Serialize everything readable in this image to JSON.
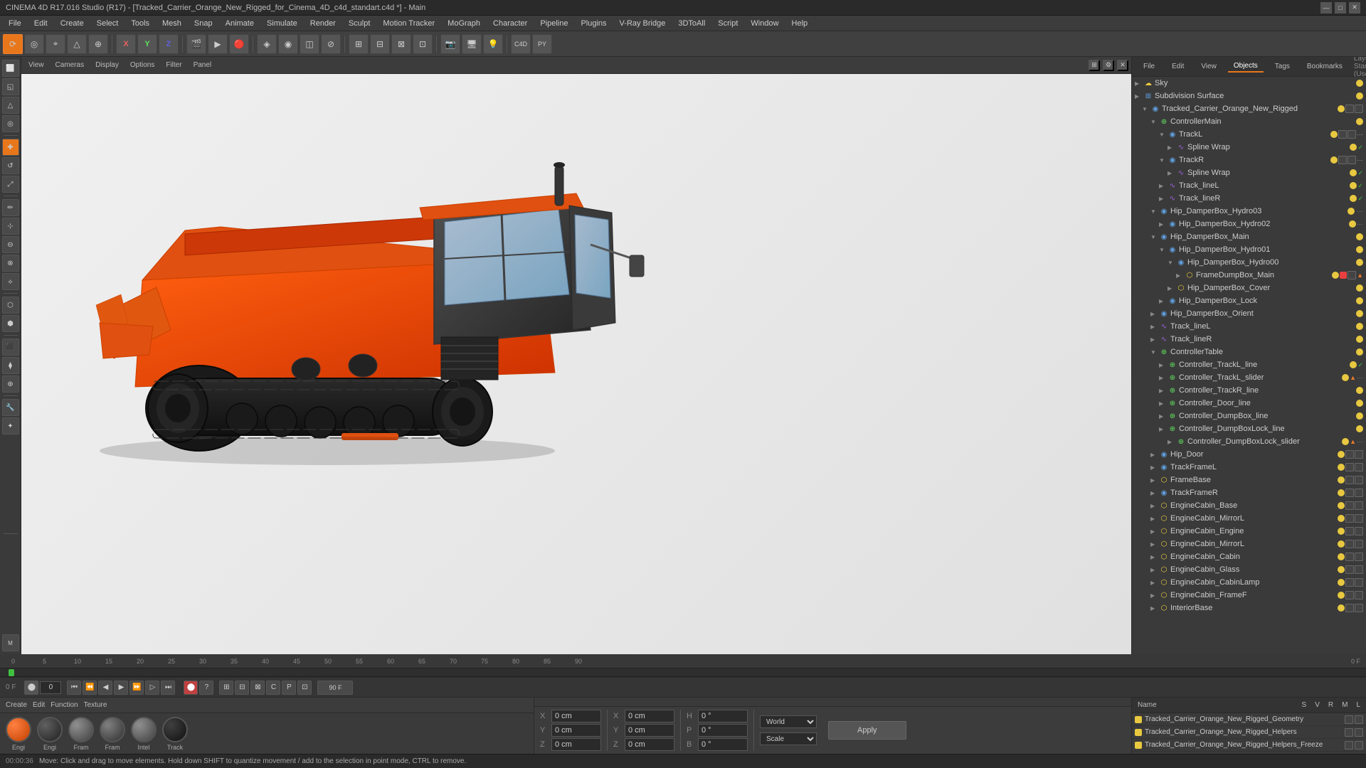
{
  "titleBar": {
    "title": "CINEMA 4D R17.016 Studio (R17) - [Tracked_Carrier_Orange_New_Rigged_for_Cinema_4D_c4d_standart.c4d *] - Main",
    "minimize": "—",
    "maximize": "□",
    "close": "✕"
  },
  "menuBar": {
    "items": [
      "File",
      "Edit",
      "Create",
      "Select",
      "Tools",
      "Mesh",
      "Snap",
      "Animate",
      "Simulate",
      "Render",
      "Sculpt",
      "Motion Tracker",
      "MoGraph",
      "Character",
      "Pipeline",
      "Plugins",
      "V-Ray Bridge",
      "3DToAll",
      "Script",
      "Window",
      "Help"
    ]
  },
  "viewport": {
    "tabs": [
      "View",
      "Cameras",
      "Display",
      "Options",
      "Filter",
      "Panel"
    ]
  },
  "rightPanel": {
    "tabs": [
      "File",
      "Edit",
      "View",
      "Objects",
      "Tags",
      "Bookmarks"
    ],
    "header": "Layout: Startup (Users)",
    "nodes": [
      {
        "id": "sky",
        "label": "Sky",
        "indent": 0,
        "type": "obj",
        "expanded": false
      },
      {
        "id": "subdiv",
        "label": "Subdivision Surface",
        "indent": 0,
        "type": "null",
        "expanded": false
      },
      {
        "id": "tracked",
        "label": "Tracked_Carrier_Orange_New_Rigged",
        "indent": 1,
        "type": "null",
        "expanded": true
      },
      {
        "id": "ctrlmain",
        "label": "ControllerMain",
        "indent": 2,
        "type": "ctrl",
        "expanded": true
      },
      {
        "id": "trackl",
        "label": "TrackL",
        "indent": 3,
        "type": "null",
        "expanded": true
      },
      {
        "id": "splinewrap1",
        "label": "Spline Wrap",
        "indent": 4,
        "type": "spline",
        "expanded": false
      },
      {
        "id": "trackr",
        "label": "TrackR",
        "indent": 3,
        "type": "null",
        "expanded": true
      },
      {
        "id": "splinewrap2",
        "label": "Spline Wrap",
        "indent": 4,
        "type": "spline",
        "expanded": false
      },
      {
        "id": "trackline1",
        "label": "Track_lineL",
        "indent": 3,
        "type": "obj",
        "expanded": false
      },
      {
        "id": "trackline2",
        "label": "Track_lineR",
        "indent": 3,
        "type": "obj",
        "expanded": false
      },
      {
        "id": "hipdamper03",
        "label": "Hip_DamperBox_Hydro03",
        "indent": 2,
        "type": "null",
        "expanded": true
      },
      {
        "id": "hipdamper02",
        "label": "Hip_DamperBox_Hydro02",
        "indent": 3,
        "type": "null",
        "expanded": false
      },
      {
        "id": "hipdampermain",
        "label": "Hip_DamperBox_Main",
        "indent": 2,
        "type": "null",
        "expanded": true
      },
      {
        "id": "hipdamper01",
        "label": "Hip_DamperBox_Hydro01",
        "indent": 3,
        "type": "null",
        "expanded": true
      },
      {
        "id": "hipdamper00",
        "label": "Hip_DamperBox_Hydro00",
        "indent": 4,
        "type": "null",
        "expanded": true
      },
      {
        "id": "framedump",
        "label": "FrameDumpBox_Main",
        "indent": 5,
        "type": "obj",
        "expanded": false
      },
      {
        "id": "hipdampercover",
        "label": "Hip_DamperBox_Cover",
        "indent": 4,
        "type": "obj",
        "expanded": false
      },
      {
        "id": "hipdamperlock",
        "label": "Hip_DamperBox_Lock",
        "indent": 3,
        "type": "null",
        "expanded": false
      },
      {
        "id": "hipdamperorient",
        "label": "Hip_DamperBox_Orient",
        "indent": 2,
        "type": "null",
        "expanded": false
      },
      {
        "id": "tracklineL2",
        "label": "Track_lineL",
        "indent": 2,
        "type": "obj",
        "expanded": false
      },
      {
        "id": "tracklineR2",
        "label": "Track_lineR",
        "indent": 2,
        "type": "obj",
        "expanded": false
      },
      {
        "id": "ctrltable",
        "label": "ControllerTable",
        "indent": 2,
        "type": "null",
        "expanded": true
      },
      {
        "id": "ctrltrackl",
        "label": "Controller_TrackL_line",
        "indent": 3,
        "type": "ctrl",
        "expanded": false
      },
      {
        "id": "ctrltracklslider",
        "label": "Controller_TrackL_slider",
        "indent": 3,
        "type": "ctrl",
        "expanded": false
      },
      {
        "id": "ctrltrackr",
        "label": "Controller_TrackR_line",
        "indent": 3,
        "type": "ctrl",
        "expanded": false
      },
      {
        "id": "ctrldoor",
        "label": "Controller_Door_line",
        "indent": 3,
        "type": "ctrl",
        "expanded": false
      },
      {
        "id": "ctrldumpbox",
        "label": "Controller_DumpBox_line",
        "indent": 3,
        "type": "ctrl",
        "expanded": false
      },
      {
        "id": "ctrldumpboxlock",
        "label": "Controller_DumpBoxLock_line",
        "indent": 3,
        "type": "ctrl",
        "expanded": false
      },
      {
        "id": "ctrldumpboxlockslider",
        "label": "Controller_DumpBoxLock_slider",
        "indent": 4,
        "type": "ctrl",
        "expanded": false
      },
      {
        "id": "hipdoor",
        "label": "Hip_Door",
        "indent": 2,
        "type": "null",
        "expanded": false
      },
      {
        "id": "trackframe",
        "label": "TrackFrameL",
        "indent": 2,
        "type": "null",
        "expanded": false
      },
      {
        "id": "framebase",
        "label": "FrameBase",
        "indent": 2,
        "type": "obj",
        "expanded": false
      },
      {
        "id": "trackframer",
        "label": "TrackFrameR",
        "indent": 2,
        "type": "null",
        "expanded": false
      },
      {
        "id": "enginecabin",
        "label": "EngineCabin_Base",
        "indent": 2,
        "type": "obj",
        "expanded": false
      },
      {
        "id": "enginecabinmirrorl",
        "label": "EngineCabin_MirrorL",
        "indent": 2,
        "type": "obj",
        "expanded": false
      },
      {
        "id": "enginecabinengine",
        "label": "EngineCabin_Engine",
        "indent": 2,
        "type": "obj",
        "expanded": false
      },
      {
        "id": "enginecabinmirrorr",
        "label": "EngineCabin_MirrorL",
        "indent": 2,
        "type": "obj",
        "expanded": false
      },
      {
        "id": "enginecabincabin",
        "label": "EngineCabin_Cabin",
        "indent": 2,
        "type": "obj",
        "expanded": false
      },
      {
        "id": "enginecabinglass",
        "label": "EngineCabin_Glass",
        "indent": 2,
        "type": "obj",
        "expanded": false
      },
      {
        "id": "enginecabinlamp",
        "label": "EngineCabin_CabinLamp",
        "indent": 2,
        "type": "obj",
        "expanded": false
      },
      {
        "id": "enginecabinframe",
        "label": "EngineCabin_FrameF",
        "indent": 2,
        "type": "obj",
        "expanded": false
      },
      {
        "id": "interiorbase",
        "label": "InteriorBase",
        "indent": 2,
        "type": "obj",
        "expanded": false
      }
    ]
  },
  "bottomPanel": {
    "materialTabs": [
      "Create",
      "Edit",
      "Function",
      "Texture"
    ],
    "materials": [
      {
        "name": "Engi",
        "type": "orange"
      },
      {
        "name": "Engi",
        "type": "dark"
      },
      {
        "name": "Fram",
        "type": "gray"
      },
      {
        "name": "Fram",
        "type": "inner"
      },
      {
        "name": "Intel",
        "type": "gray"
      },
      {
        "name": "Track",
        "type": "track"
      }
    ]
  },
  "coordinates": {
    "x_label": "X",
    "y_label": "Y",
    "z_label": "Z",
    "x_val": "0 cm",
    "y_val": "0 cm",
    "z_val": "0 cm",
    "sx_label": "X",
    "sy_label": "Y",
    "sz_label": "Z",
    "sx_val": "0 cm",
    "sy_val": "0 cm",
    "sz_val": "0 cm",
    "h_label": "H",
    "p_label": "P",
    "b_label": "B",
    "h_val": "0 °",
    "p_val": "0 °",
    "b_val": "0 °",
    "coord_sys": "World",
    "scale_label": "Scale",
    "apply_label": "Apply"
  },
  "timeline": {
    "start": "0",
    "end": "90 F",
    "current": "0 F",
    "fps": "90 F",
    "marks": [
      "0",
      "5",
      "10",
      "15",
      "20",
      "25",
      "30",
      "35",
      "40",
      "45",
      "50",
      "55",
      "60",
      "65",
      "70",
      "75",
      "80",
      "85",
      "90"
    ]
  },
  "statusBar": {
    "time": "00:00:36",
    "message": "Move: Click and drag to move elements. Hold down SHIFT to quantize movement / add to the selection in point mode, CTRL to remove."
  },
  "rightBottomPanel": {
    "header_name": "Name",
    "header_s": "S",
    "header_v": "V",
    "header_r": "R",
    "header_m": "M",
    "header_l": "L",
    "items": [
      {
        "label": "Tracked_Carrier_Orange_New_Rigged_Geometry",
        "color": "#e8c840"
      },
      {
        "label": "Tracked_Carrier_Orange_New_Rigged_Helpers",
        "color": "#e8c840"
      },
      {
        "label": "Tracked_Carrier_Orange_New_Rigged_Helpers_Freeze",
        "color": "#e8c840"
      }
    ]
  }
}
